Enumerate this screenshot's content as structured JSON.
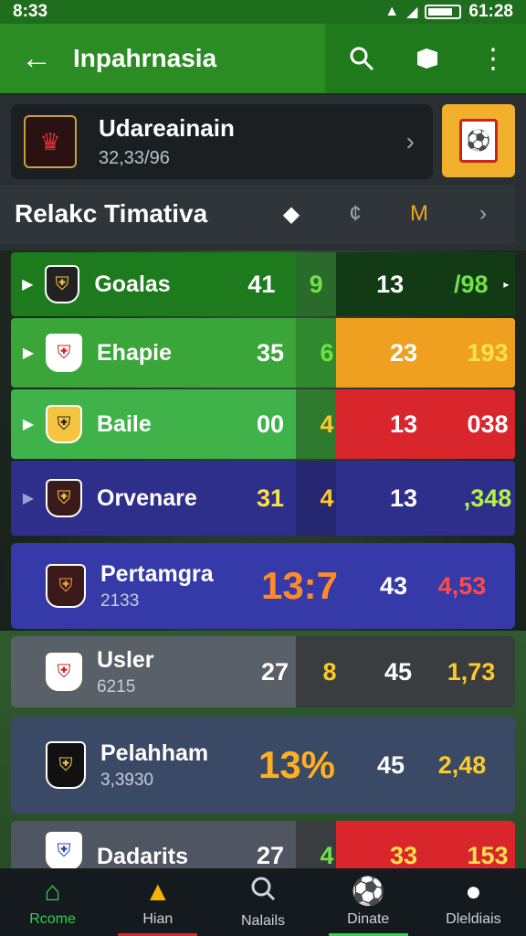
{
  "status_bar": {
    "time": "8:33",
    "clock": "61:28"
  },
  "app_bar": {
    "title": "Inpahrnasia"
  },
  "league": {
    "name": "Udareainain",
    "sub": "32,33/96"
  },
  "filter": {
    "title": "Relakc Timativa"
  },
  "rows": [
    {
      "name": "Goalas",
      "a": "41",
      "b": "9",
      "c": "13",
      "d": "/98",
      "has_sub": false
    },
    {
      "name": "Ehapie",
      "a": "35",
      "b": "6",
      "c": "23",
      "d": "193",
      "has_sub": false
    },
    {
      "name": "Baile",
      "a": "00",
      "b": "4",
      "c": "13",
      "d": "038",
      "has_sub": false
    },
    {
      "name": "Orvenare",
      "a": "31",
      "b": "4",
      "c": "13",
      "d": ",348",
      "has_sub": false
    },
    {
      "name": "Pertamgra",
      "sub": "2133",
      "big": "13:7",
      "c": "43",
      "d": "4,53",
      "has_sub": true
    },
    {
      "name": "Usler",
      "sub": "6215",
      "a": "27",
      "b": "8",
      "c": "45",
      "d": "1,73",
      "has_sub": true
    },
    {
      "name": "Pelahham",
      "sub": "3,3930",
      "big": "13%",
      "c": "45",
      "d": "2,48",
      "has_sub": true
    },
    {
      "name": "Dadarits",
      "a": "27",
      "b": "4",
      "c": "33",
      "d": "153",
      "has_sub": false
    }
  ],
  "nav": [
    {
      "label": "Rcome",
      "icon": "home-icon"
    },
    {
      "label": "Hian",
      "icon": "warning-icon"
    },
    {
      "label": "Nalails",
      "icon": "search-icon"
    },
    {
      "label": "Dinate",
      "icon": "ball-icon"
    },
    {
      "label": "Dleldiais",
      "icon": "person-icon"
    }
  ],
  "colors": {
    "accent": "#35d14a",
    "brand_green": "#2b8c23",
    "orange": "#f1b02c"
  }
}
